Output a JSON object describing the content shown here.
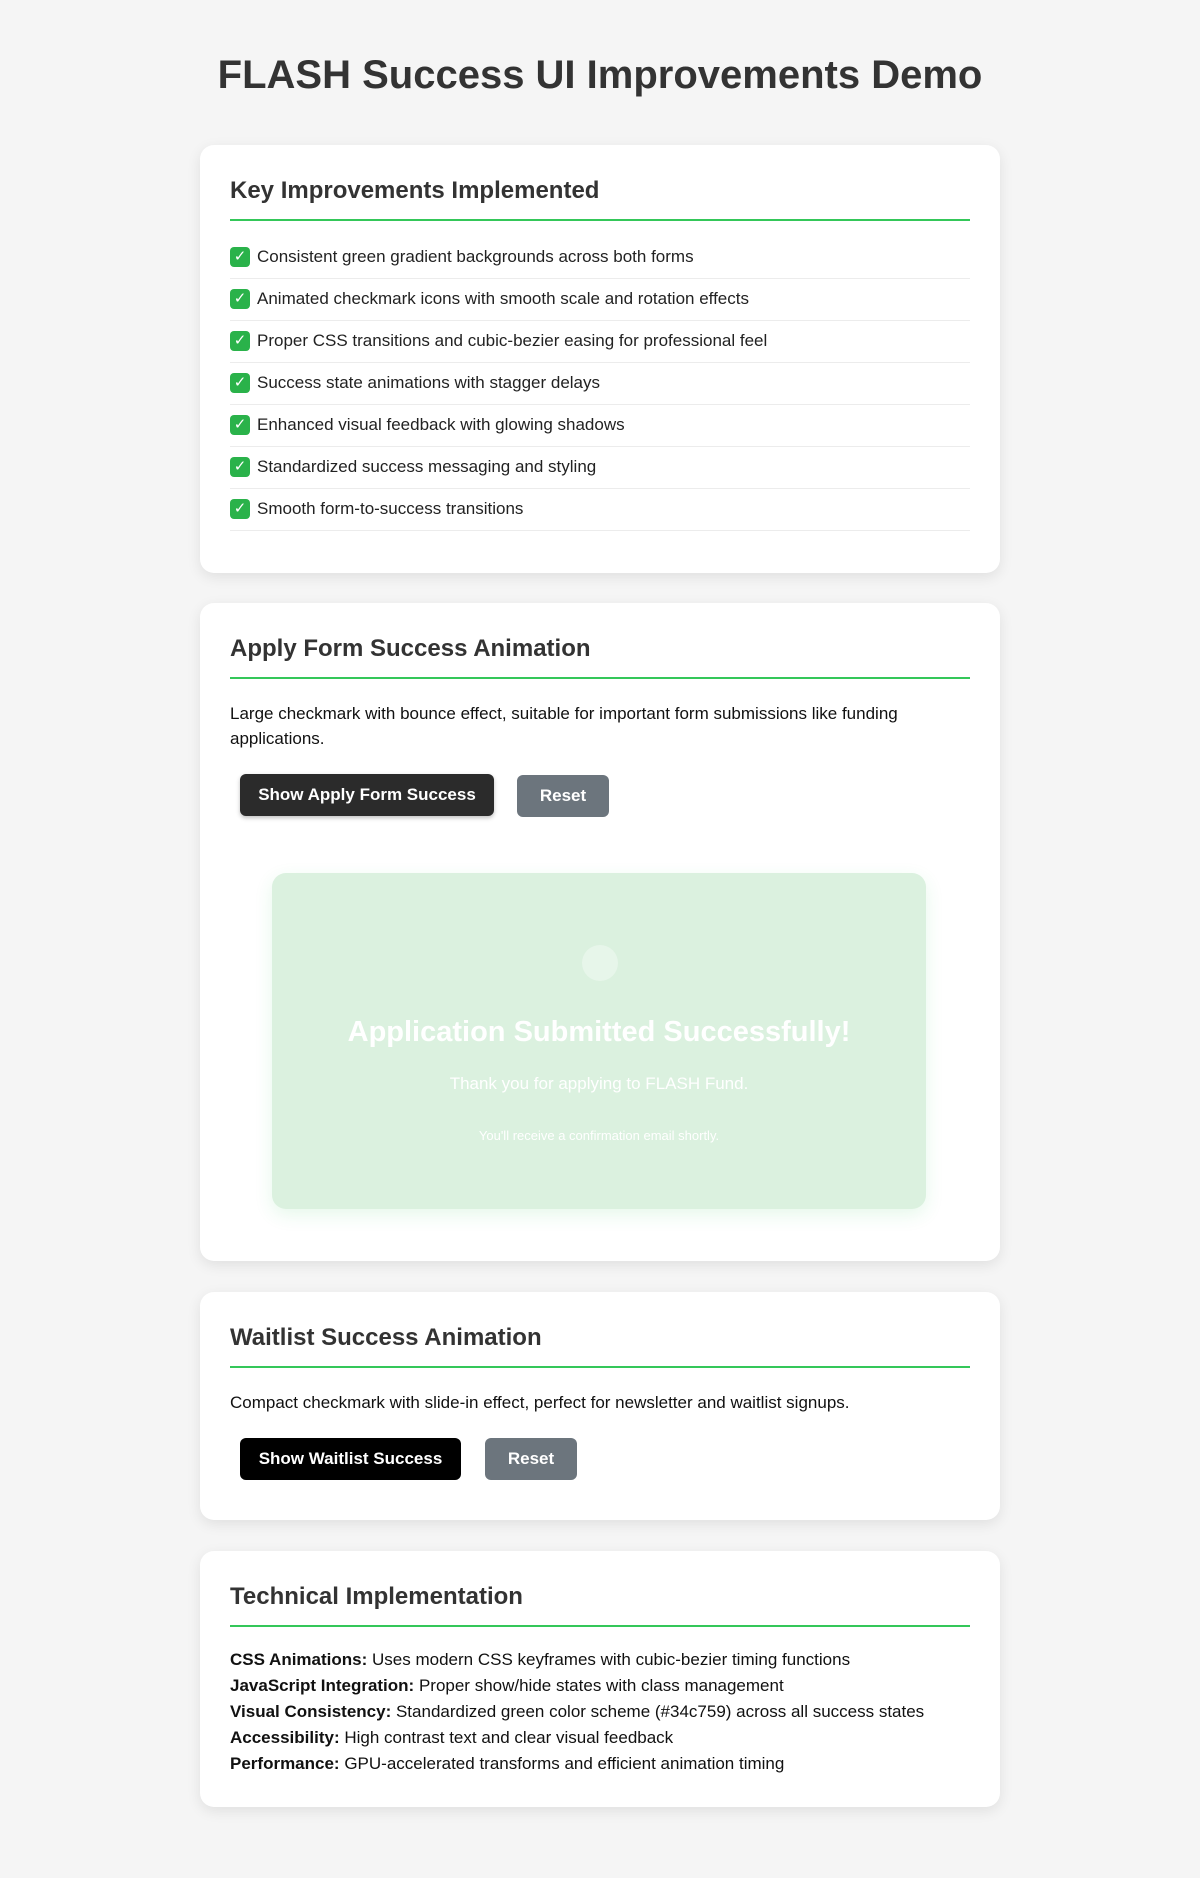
{
  "page": {
    "title": "FLASH Success UI Improvements Demo"
  },
  "improvements": {
    "heading": "Key Improvements Implemented",
    "items": [
      {
        "icon": "check-mark-button-emoji",
        "text": "Consistent green gradient backgrounds across both forms"
      },
      {
        "icon": "check-mark-button-emoji",
        "text": "Animated checkmark icons with smooth scale and rotation effects"
      },
      {
        "icon": "check-mark-button-emoji",
        "text": "Proper CSS transitions and cubic-bezier easing for professional feel"
      },
      {
        "icon": "check-mark-button-emoji",
        "text": "Success state animations with stagger delays"
      },
      {
        "icon": "check-mark-button-emoji",
        "text": "Enhanced visual feedback with glowing shadows"
      },
      {
        "icon": "check-mark-button-emoji",
        "text": "Standardized success messaging and styling"
      },
      {
        "icon": "check-mark-button-emoji",
        "text": "Smooth form-to-success transitions"
      }
    ]
  },
  "apply_demo": {
    "heading": "Apply Form Success Animation",
    "description": "Large checkmark with bounce effect, suitable for important form submissions like funding applications.",
    "show_button": "Show Apply Form Success",
    "reset_button": "Reset",
    "success": {
      "icon": "checkmark-icon",
      "title": "Application Submitted Successfully!",
      "subtitle": "Thank you for applying to FLASH Fund.",
      "note": "You'll receive a confirmation email shortly."
    }
  },
  "waitlist_demo": {
    "heading": "Waitlist Success Animation",
    "description": "Compact checkmark with slide-in effect, perfect for newsletter and waitlist signups.",
    "show_button": "Show Waitlist Success",
    "reset_button": "Reset"
  },
  "technical": {
    "heading": "Technical Implementation",
    "items": [
      {
        "label": "CSS Animations:",
        "text": " Uses modern CSS keyframes with cubic-bezier timing functions"
      },
      {
        "label": "JavaScript Integration:",
        "text": " Proper show/hide states with class management"
      },
      {
        "label": "Visual Consistency:",
        "text": " Standardized green color scheme (#34c759) across all success states"
      },
      {
        "label": "Accessibility:",
        "text": " High contrast text and clear visual feedback"
      },
      {
        "label": "Performance:",
        "text": " GPU-accelerated transforms and efficient animation timing"
      }
    ]
  },
  "colors": {
    "accent": "#34c759",
    "page_background": "#f5f5f5",
    "success_panel": "#dbf1df",
    "reset_button": "#6c757d"
  }
}
